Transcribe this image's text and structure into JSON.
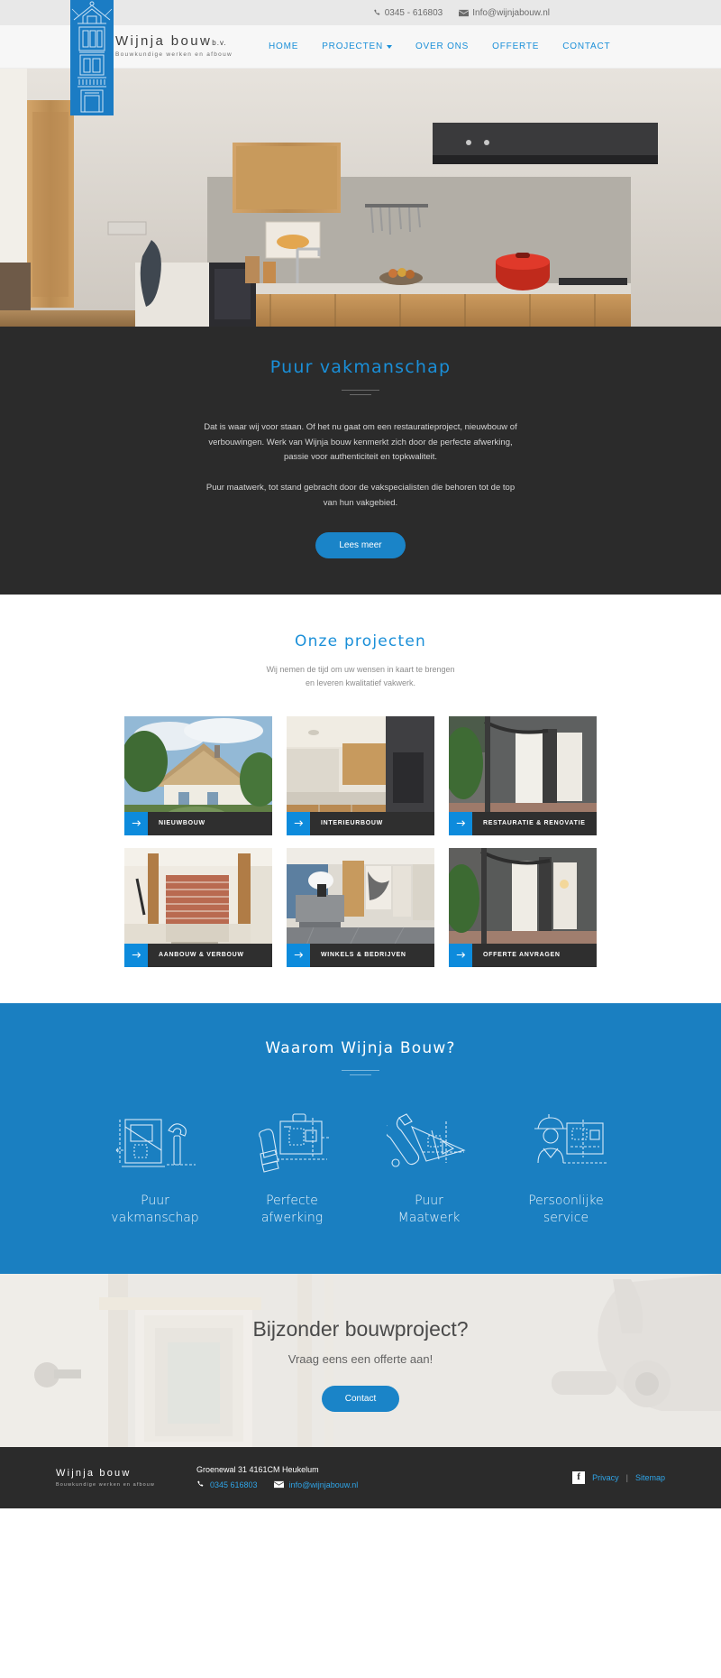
{
  "colors": {
    "brand_blue": "#1a8fd8",
    "accent_blue": "#0d8bdc",
    "section_blue": "#1a7fc1",
    "dark": "#2b2b2b",
    "topbar_bg": "#e8e8e8"
  },
  "topbar": {
    "phone_icon": "phone-icon",
    "phone": "0345 - 616803",
    "mail_icon": "envelope-icon",
    "email": "Info@wijnjabouw.nl"
  },
  "header": {
    "brand_name": "Wijnja bouw",
    "brand_suffix": "b.v.",
    "brand_tagline": "Bouwkundige werken en afbouw",
    "logo_icon": "wijnja-building-logo",
    "nav": [
      {
        "label": "HOME",
        "has_dropdown": false
      },
      {
        "label": "PROJECTEN",
        "has_dropdown": true
      },
      {
        "label": "OVER ONS",
        "has_dropdown": false
      },
      {
        "label": "OFFERTE",
        "has_dropdown": false
      },
      {
        "label": "CONTACT",
        "has_dropdown": false
      }
    ]
  },
  "hero": {
    "alt": "modern oak kitchen with red dutch oven"
  },
  "intro": {
    "heading": "Puur vakmanschap",
    "paragraph1": "Dat is waar wij voor staan. Of het nu gaat om een restauratieproject, nieuwbouw of verbouwingen. Werk van Wijnja bouw kenmerkt zich door de perfecte afwerking, passie voor authenticiteit en topkwaliteit.",
    "paragraph2": "Puur maatwerk, tot stand gebracht door de vakspecialisten die behoren tot de top van hun vakgebied.",
    "button": "Lees meer"
  },
  "projects": {
    "heading": "Onze projecten",
    "subline1": "Wij nemen de tijd om uw wensen in kaart te brengen",
    "subline2": "en leveren kwalitatief vakwerk.",
    "cards": [
      {
        "label": "NIEUWBOUW",
        "icon": "arrow-right-icon"
      },
      {
        "label": "INTERIEURBOUW",
        "icon": "arrow-right-icon"
      },
      {
        "label": "RESTAURATIE & RENOVATIE",
        "icon": "arrow-right-icon"
      },
      {
        "label": "AANBOUW & VERBOUW",
        "icon": "arrow-right-icon"
      },
      {
        "label": "WINKELS & BEDRIJVEN",
        "icon": "arrow-right-icon"
      },
      {
        "label": "OFFERTE ANVRAGEN",
        "icon": "arrow-right-icon"
      }
    ]
  },
  "why": {
    "heading": "Waarom Wijnja Bouw?",
    "features": [
      {
        "line1": "Puur",
        "line2": "vakmanschap",
        "icon": "blueprint-hammer-icon"
      },
      {
        "line1": "Perfecte",
        "line2": "afwerking",
        "icon": "blueprint-paintbrush-icon"
      },
      {
        "line1": "Puur",
        "line2": "Maatwerk",
        "icon": "blueprint-wrench-ruler-icon"
      },
      {
        "line1": "Persoonlijke",
        "line2": "service",
        "icon": "blueprint-worker-icon"
      }
    ]
  },
  "cta": {
    "heading": "Bijzonder bouwproject?",
    "subline": "Vraag eens een offerte aan!",
    "button": "Contact"
  },
  "footer": {
    "brand_name": "Wijnja bouw",
    "brand_tagline": "Bouwkundige werken en afbouw",
    "address": "Groenewal 31 4161CM Heukelum",
    "phone_icon": "phone-icon",
    "phone": "0345 616803",
    "mail_icon": "envelope-icon",
    "email": "info@wijnjabouw.nl",
    "social_icon": "facebook-icon",
    "privacy": "Privacy",
    "separator": "|",
    "sitemap": "Sitemap"
  }
}
